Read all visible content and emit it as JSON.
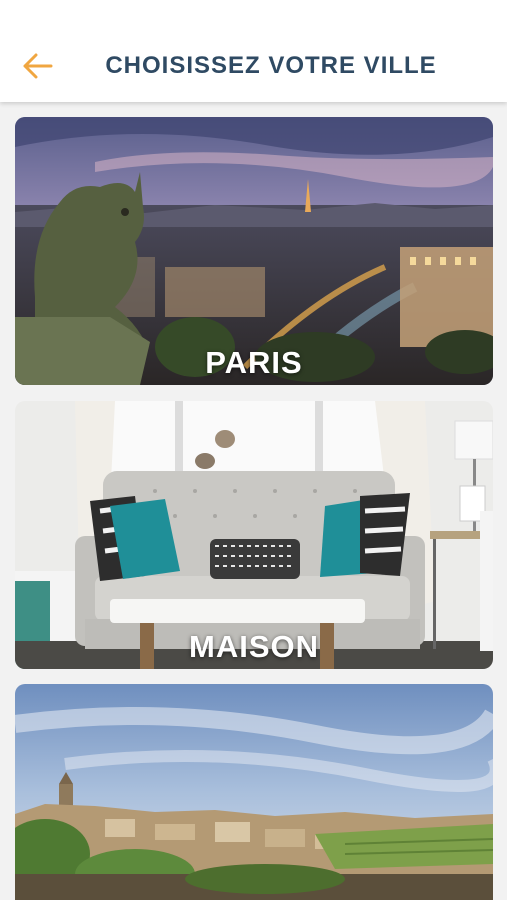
{
  "header": {
    "title": "CHOISISSEZ VOTRE VILLE",
    "back_icon": "arrow-left-icon",
    "accent_color": "#f0a640",
    "title_color": "#2f4a63"
  },
  "cities": [
    {
      "label": "PARIS",
      "image": "paris-skyline-with-gargoyle-image"
    },
    {
      "label": "MAISON",
      "image": "living-room-sofa-image"
    },
    {
      "label": "",
      "image": "village-countryside-image"
    }
  ]
}
